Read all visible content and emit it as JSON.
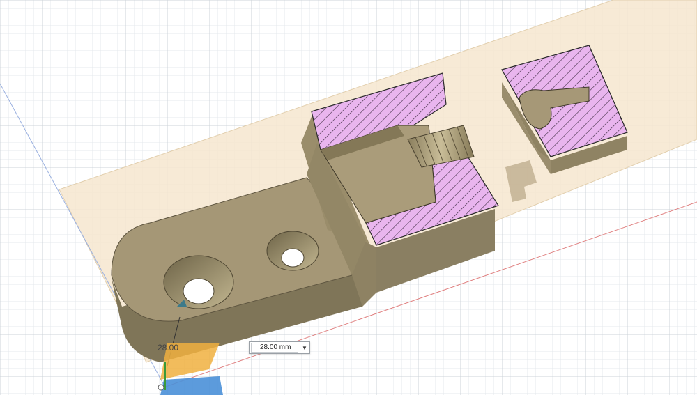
{
  "dimension": {
    "label": "28.00",
    "input_value": "28.00 mm",
    "dropdown_icon": "caret-down-icon"
  },
  "colors": {
    "grid_minor": "#e4e8ec",
    "grid_major": "#c9d0d6",
    "plane_fill": "#f6e6cf",
    "body_top": "#a89a78",
    "body_side": "#8f8262",
    "body_front": "#7d7356",
    "section_hatch": "#e8b4ec",
    "axis_red": "#e06060",
    "axis_blue": "#6a8fd8"
  }
}
